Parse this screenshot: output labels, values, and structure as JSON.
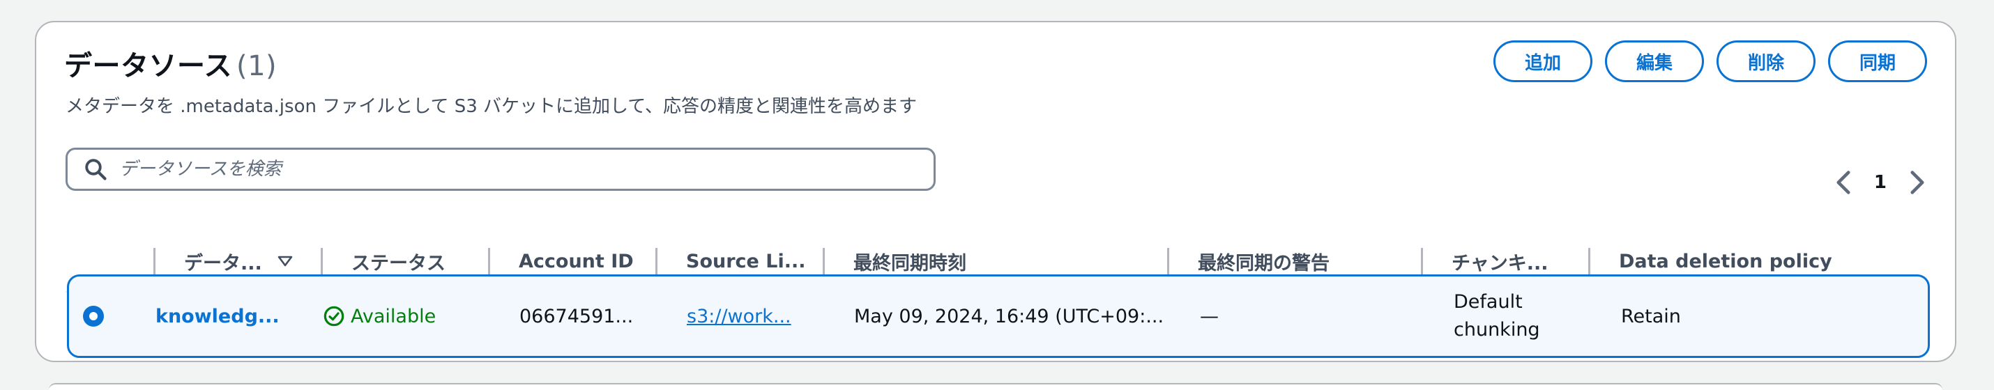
{
  "header": {
    "title": "データソース",
    "count": "(1)",
    "description": "メタデータを .metadata.json ファイルとして S3 バケットに追加して、応答の精度と関連性を高めます"
  },
  "actions": {
    "add": "追加",
    "edit": "編集",
    "delete": "削除",
    "sync": "同期"
  },
  "search": {
    "placeholder": "データソースを検索",
    "value": ""
  },
  "pagination": {
    "current_page": "1"
  },
  "table": {
    "columns": [
      "データ...",
      "ステータス",
      "Account ID",
      "Source Li...",
      "最終同期時刻",
      "最終同期の警告",
      "チャンキ...",
      "Data deletion policy"
    ],
    "rows": [
      {
        "name": "knowledg...",
        "status": "Available",
        "account_id": "06674591...",
        "source_link": "s3://work...",
        "last_sync_time": "May 09, 2024, 16:49 (UTC+09:...",
        "last_sync_warning": "—",
        "chunking": "Default chunking",
        "deletion_policy": "Retain"
      }
    ]
  },
  "colors": {
    "accent": "#0972d3",
    "success": "#037f0c",
    "border": "#b4b4bb"
  },
  "icons": {
    "search": "search-icon",
    "prev": "chevron-left-icon",
    "next": "chevron-right-icon",
    "sort": "sort-down-icon",
    "status": "check-circle-icon"
  }
}
